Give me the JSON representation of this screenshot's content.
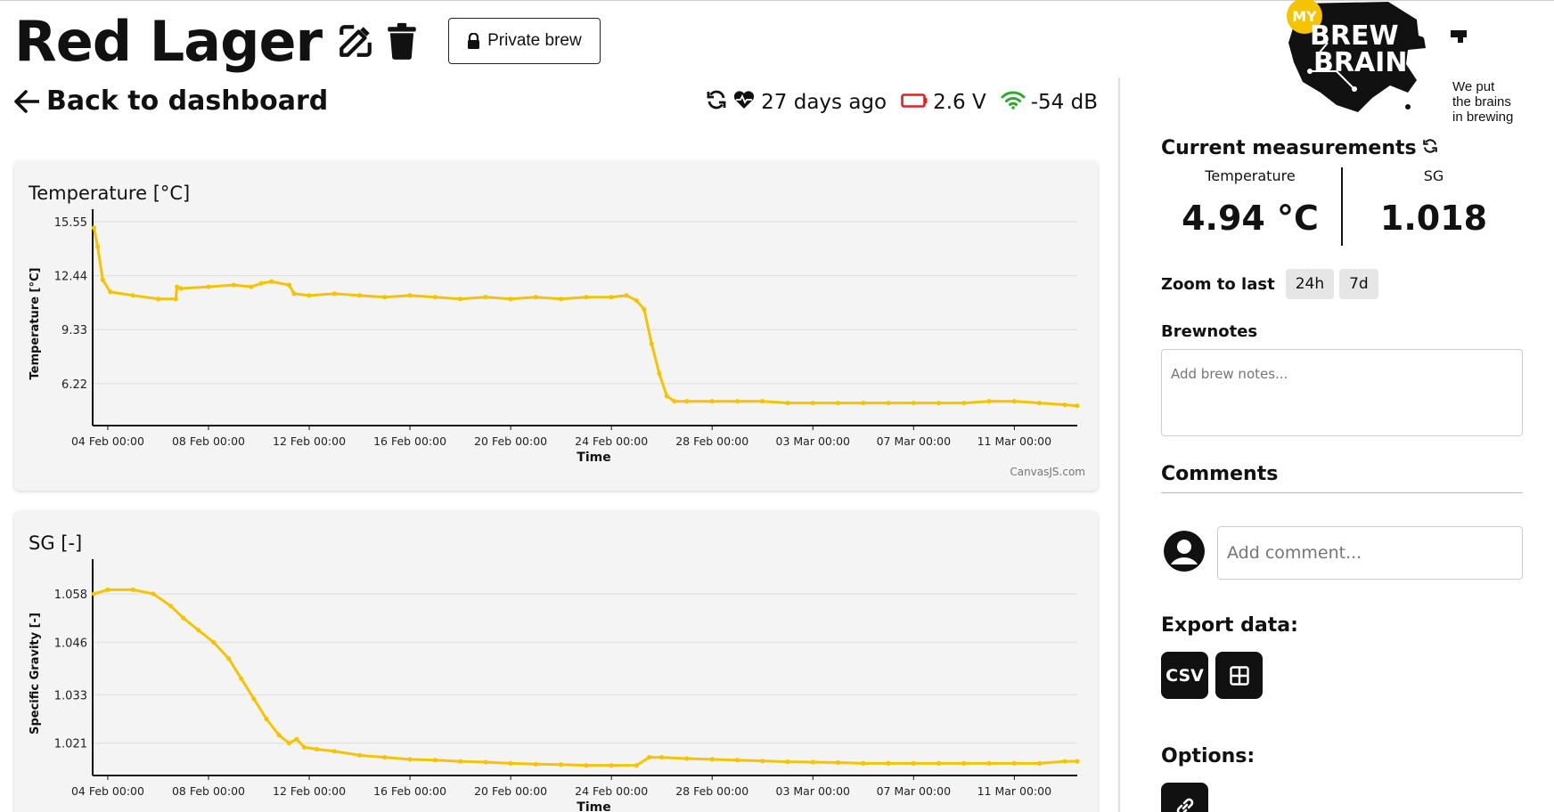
{
  "header": {
    "title": "Red Lager",
    "edit_icon": "edit-icon",
    "delete_icon": "trash-icon",
    "private_label": "Private brew",
    "back_label": "Back to dashboard"
  },
  "status": {
    "last_seen": "27 days ago",
    "battery": "2.6 V",
    "signal": "-54 dB",
    "battery_color": "#e02020",
    "signal_color": "#2fa82f"
  },
  "logo": {
    "badge": "MY",
    "line1": "BREW",
    "line2": "BRAIN",
    "tagline1": "We put",
    "tagline2": "the brains",
    "tagline3": "in brewing",
    "badge_color": "#f5c400"
  },
  "sidebar": {
    "current_title": "Current measurements",
    "temperature_label": "Temperature",
    "temperature_value": "4.94 °C",
    "sg_label": "SG",
    "sg_value": "1.018",
    "zoom_label": "Zoom to last",
    "zoom_24h": "24h",
    "zoom_7d": "7d",
    "brewnotes_label": "Brewnotes",
    "brewnotes_placeholder": "Add brew notes...",
    "comments_title": "Comments",
    "comment_placeholder": "Add comment...",
    "export_title": "Export data:",
    "export_csv": "CSV",
    "options_title": "Options:"
  },
  "credit": "CanvasJS.com",
  "chart_data": [
    {
      "type": "line",
      "title": "Temperature [°C]",
      "xlabel": "Time",
      "ylabel": "Temperature [°C]",
      "x_ticks": [
        "04 Feb 00:00",
        "08 Feb 00:00",
        "12 Feb 00:00",
        "16 Feb 00:00",
        "20 Feb 00:00",
        "24 Feb 00:00",
        "28 Feb 00:00",
        "03 Mar 00:00",
        "07 Mar 00:00",
        "11 Mar 00:00"
      ],
      "y_ticks": [
        "15.55",
        "12.44",
        "9.33",
        "6.22"
      ],
      "ylim": [
        3.8,
        15.55
      ],
      "xlim_days": [
        3.4,
        42.5
      ],
      "grid": true,
      "color": "#f5c400",
      "x_days": [
        3.45,
        3.6,
        3.8,
        4.1,
        5.0,
        6.0,
        6.7,
        6.75,
        6.9,
        8.0,
        9.0,
        9.7,
        10.1,
        10.5,
        11.2,
        11.4,
        12.0,
        13.0,
        14.0,
        15.0,
        16.0,
        17.0,
        18.0,
        19.0,
        20.0,
        21.0,
        22.0,
        23.0,
        24.0,
        24.6,
        25.0,
        25.3,
        25.6,
        25.9,
        26.2,
        26.5,
        27.0,
        28.0,
        29.0,
        30.0,
        31.0,
        32.0,
        33.0,
        34.0,
        35.0,
        36.0,
        37.0,
        38.0,
        39.0,
        40.0,
        41.0,
        42.0,
        42.5
      ],
      "values": [
        15.2,
        14.1,
        12.2,
        11.5,
        11.3,
        11.1,
        11.1,
        11.8,
        11.7,
        11.8,
        11.9,
        11.8,
        12.0,
        12.1,
        11.9,
        11.4,
        11.3,
        11.4,
        11.3,
        11.2,
        11.3,
        11.2,
        11.1,
        11.2,
        11.1,
        11.2,
        11.1,
        11.2,
        11.2,
        11.3,
        11.0,
        10.5,
        8.5,
        6.8,
        5.5,
        5.2,
        5.2,
        5.2,
        5.2,
        5.2,
        5.1,
        5.1,
        5.1,
        5.1,
        5.1,
        5.1,
        5.1,
        5.1,
        5.2,
        5.2,
        5.1,
        5.0,
        4.94
      ]
    },
    {
      "type": "line",
      "title": "SG [-]",
      "xlabel": "Time",
      "ylabel": "Specific Gravity [-]",
      "x_ticks": [
        "04 Feb 00:00",
        "08 Feb 00:00",
        "12 Feb 00:00",
        "16 Feb 00:00",
        "20 Feb 00:00",
        "24 Feb 00:00",
        "28 Feb 00:00",
        "03 Mar 00:00",
        "07 Mar 00:00",
        "11 Mar 00:00"
      ],
      "y_ticks": [
        "1.058",
        "1.046",
        "1.033",
        "1.021"
      ],
      "ylim": [
        1.013,
        1.0635
      ],
      "xlim_days": [
        3.4,
        42.5
      ],
      "grid": true,
      "color": "#f5c400",
      "x_days": [
        3.45,
        4.0,
        5.0,
        5.8,
        6.5,
        7.0,
        7.6,
        8.2,
        8.8,
        9.3,
        9.8,
        10.3,
        10.8,
        11.2,
        11.5,
        11.8,
        12.3,
        13.0,
        14.0,
        15.0,
        16.0,
        17.0,
        18.0,
        19.0,
        20.0,
        21.0,
        22.0,
        23.0,
        24.0,
        25.0,
        25.5,
        26.0,
        27.0,
        28.0,
        29.0,
        30.0,
        31.0,
        32.0,
        33.0,
        34.0,
        35.0,
        36.0,
        37.0,
        38.0,
        39.0,
        40.0,
        41.0,
        42.0,
        42.5
      ],
      "values": [
        1.058,
        1.059,
        1.059,
        1.058,
        1.055,
        1.052,
        1.049,
        1.046,
        1.042,
        1.037,
        1.032,
        1.027,
        1.023,
        1.021,
        1.022,
        1.02,
        1.0195,
        1.019,
        1.018,
        1.0175,
        1.017,
        1.0168,
        1.0165,
        1.0163,
        1.016,
        1.0158,
        1.0157,
        1.0155,
        1.0155,
        1.0155,
        1.0175,
        1.0175,
        1.0172,
        1.017,
        1.0168,
        1.0166,
        1.0164,
        1.0163,
        1.0162,
        1.016,
        1.016,
        1.016,
        1.016,
        1.016,
        1.016,
        1.016,
        1.016,
        1.0165,
        1.0165
      ]
    }
  ]
}
